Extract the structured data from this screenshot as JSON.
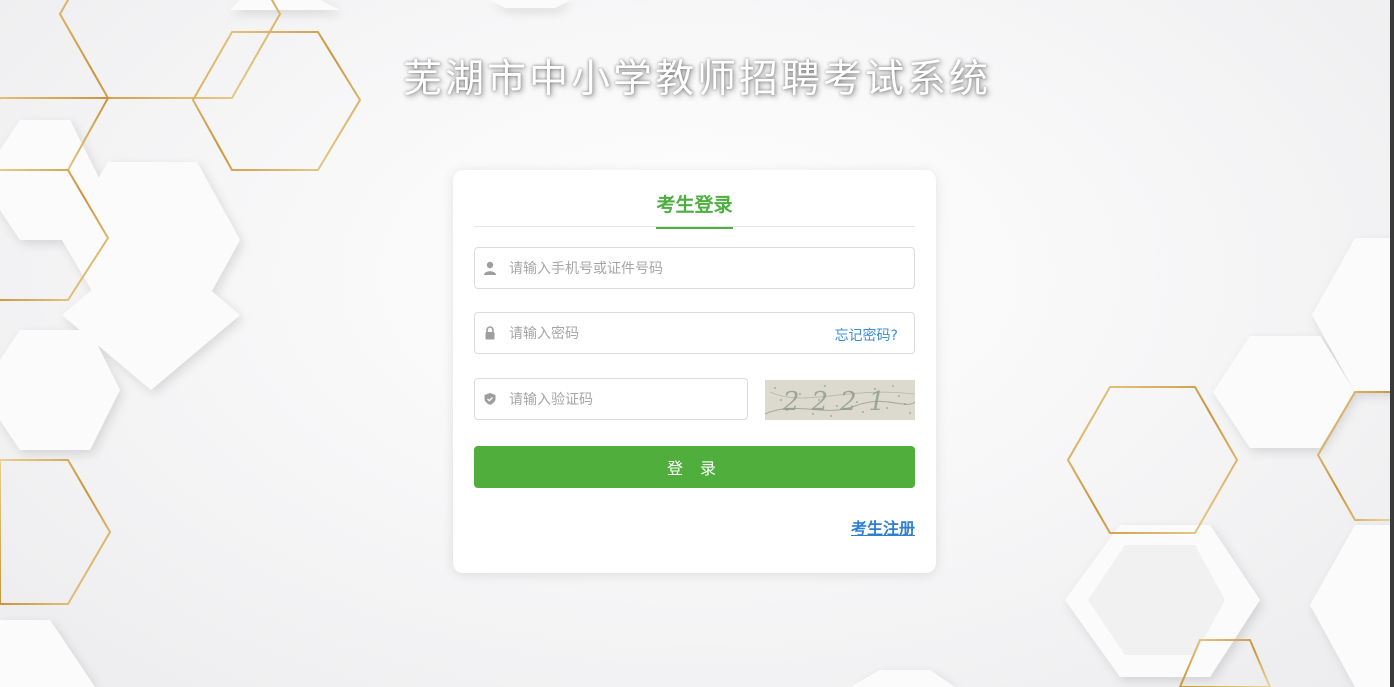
{
  "page": {
    "title": "芜湖市中小学教师招聘考试系统"
  },
  "login": {
    "tab_label": "考生登录",
    "username_placeholder": "请输入手机号或证件号码",
    "password_placeholder": "请输入密码",
    "forgot_label": "忘记密码?",
    "captcha_placeholder": "请输入验证码",
    "captcha_text": "2221",
    "submit_label": "登 录",
    "register_label": "考生注册"
  },
  "icons": {
    "username": "user-icon",
    "password": "lock-icon",
    "captcha": "shield-icon"
  },
  "colors": {
    "accent_green": "#4fae3c",
    "link_blue": "#2f7fd1",
    "gold_line": "#d4a94a"
  }
}
